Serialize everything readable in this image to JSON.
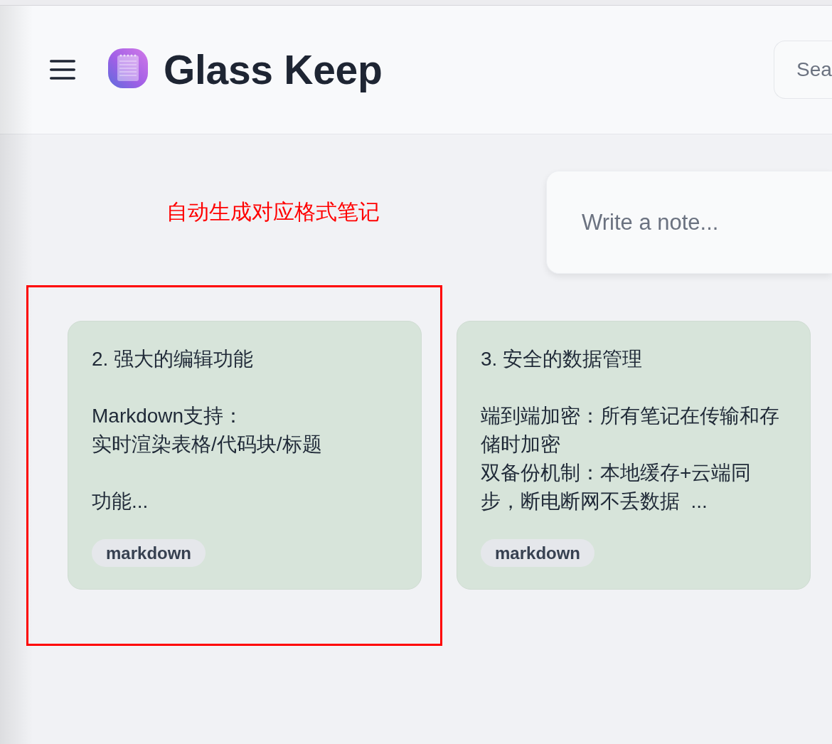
{
  "header": {
    "title": "Glass Keep",
    "search": {
      "placeholder": "Sea"
    }
  },
  "annotation": {
    "caption": "自动生成对应格式笔记"
  },
  "composer": {
    "placeholder": "Write a note..."
  },
  "notes": [
    {
      "title": "2. 强大的编辑功能",
      "body": [
        [
          "Markdown支持：",
          "实时渲染表格/代码块/标题"
        ],
        [
          "功能..."
        ]
      ],
      "tags": [
        "markdown"
      ],
      "color": "#d7e4da",
      "highlighted": true
    },
    {
      "title": "3. 安全的数据管理",
      "body": [
        [
          "端到端加密：所有笔记在传输和存储时加密",
          "双备份机制：本地缓存+云端同步，断电断网不丢数据  ..."
        ]
      ],
      "tags": [
        "markdown"
      ],
      "color": "#d7e4da",
      "highlighted": false
    }
  ]
}
